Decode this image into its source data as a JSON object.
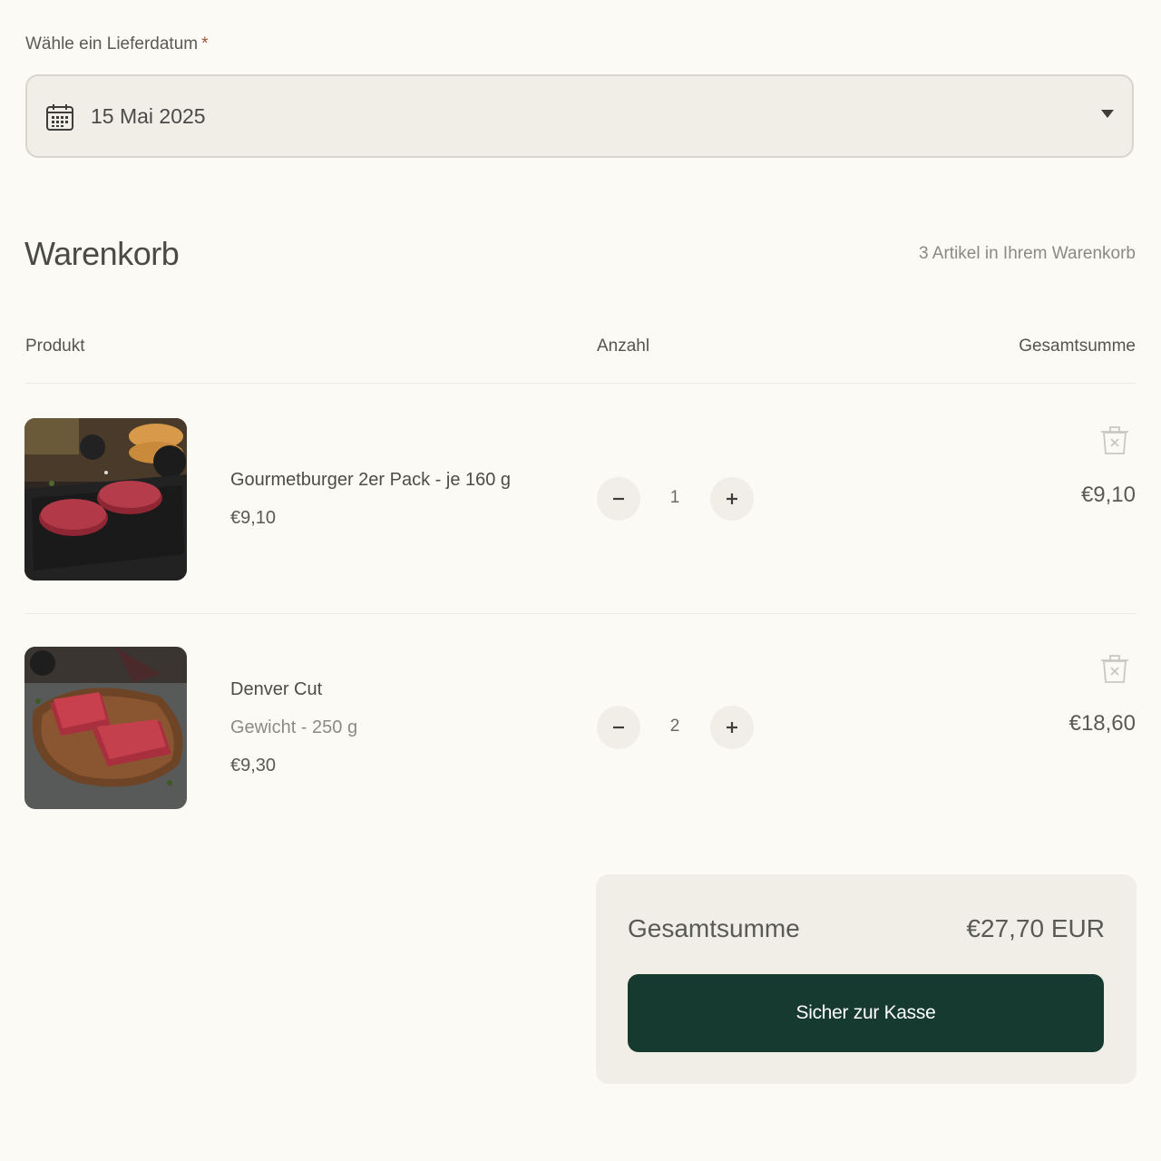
{
  "delivery": {
    "label": "Wähle ein Lieferdatum",
    "required_mark": "*",
    "selected_date": "15 Mai 2025"
  },
  "cart": {
    "title": "Warenkorb",
    "count_text": "3 Artikel in Ihrem Warenkorb",
    "columns": {
      "product": "Produkt",
      "quantity": "Anzahl",
      "total": "Gesamtsumme"
    },
    "items": [
      {
        "name": "Gourmetburger 2er Pack - je 160 g",
        "price": "€9,10",
        "quantity": "1",
        "line_total": "€9,10",
        "image": "burger-patties-photo"
      },
      {
        "name": "Denver Cut",
        "variant": "Gewicht - 250 g",
        "price": "€9,30",
        "quantity": "2",
        "line_total": "€18,60",
        "image": "denver-cut-steak-photo"
      }
    ]
  },
  "summary": {
    "label": "Gesamtsumme",
    "value": "€27,70 EUR",
    "checkout_label": "Sicher zur Kasse"
  },
  "colors": {
    "background": "#fbfaf5",
    "panel": "#f1eee8",
    "checkout_button": "#173a30",
    "required": "#a2553c"
  }
}
